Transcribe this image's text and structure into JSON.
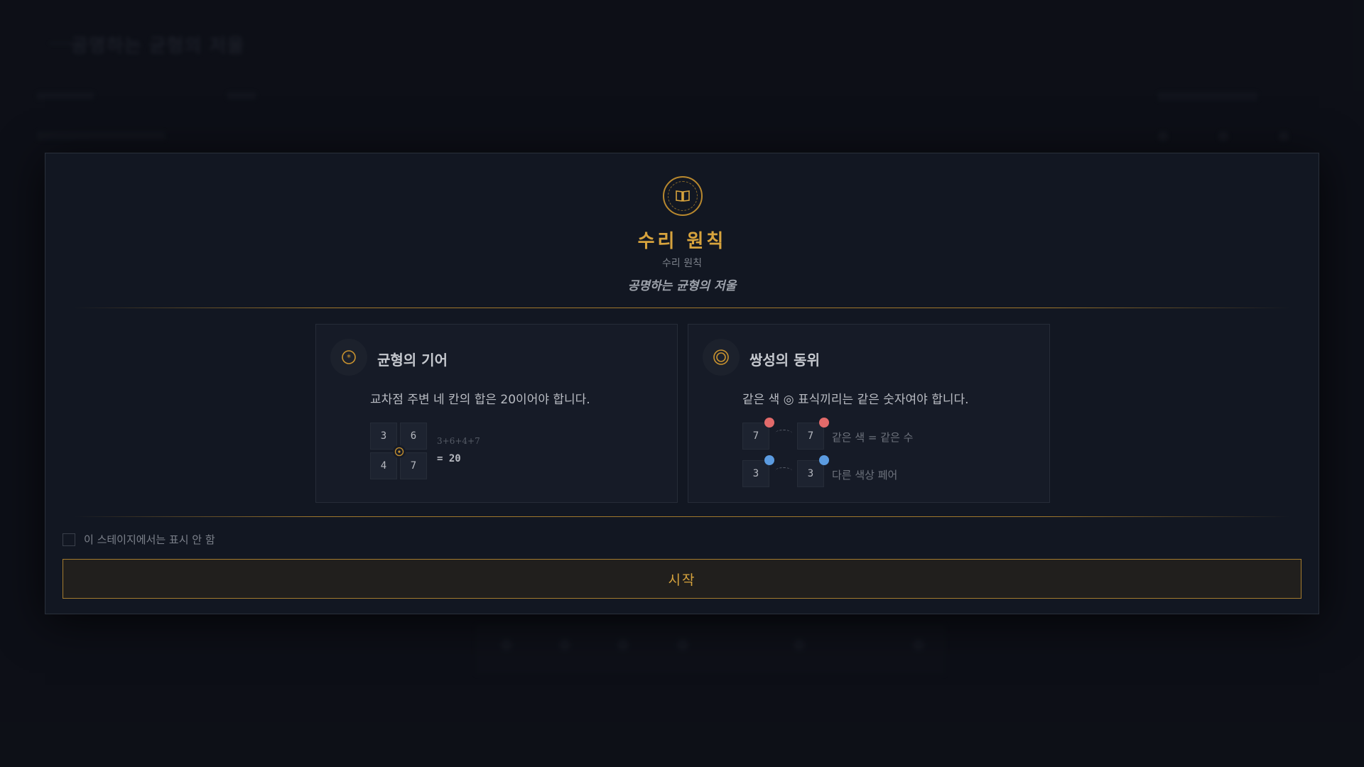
{
  "background": {
    "title": "공명하는 균형의 저울"
  },
  "modal": {
    "title": "수리 원칙",
    "subtitle": "수리 원칙",
    "tagline": "공명하는 균형의 저울",
    "emblem_icon": "book-icon",
    "accent_color": "#d7a33d"
  },
  "rules": [
    {
      "icon": "star-medallion-icon",
      "title": "균형의 기어",
      "description": "교차점 주변 네 칸의 합은 20이어야 합니다.",
      "example": {
        "cells": [
          "3",
          "6",
          "4",
          "7"
        ],
        "expression": "3+6+4+7",
        "result": "= 20"
      }
    },
    {
      "icon": "double-ring-icon",
      "title": "쌍성의 동위",
      "description": "같은 색 ◎ 표식끼리는 같은 숫자여야 합니다.",
      "example": {
        "rows": [
          {
            "left": "7",
            "right": "7",
            "color": "#e26a6a",
            "label": "같은 색 = 같은 수"
          },
          {
            "left": "3",
            "right": "3",
            "color": "#5b9be0",
            "label": "다른 색상 페어"
          }
        ]
      }
    }
  ],
  "footer": {
    "checkbox_label": "이 스테이지에서는 표시 안 함",
    "checkbox_checked": false,
    "start_button": "시작"
  }
}
